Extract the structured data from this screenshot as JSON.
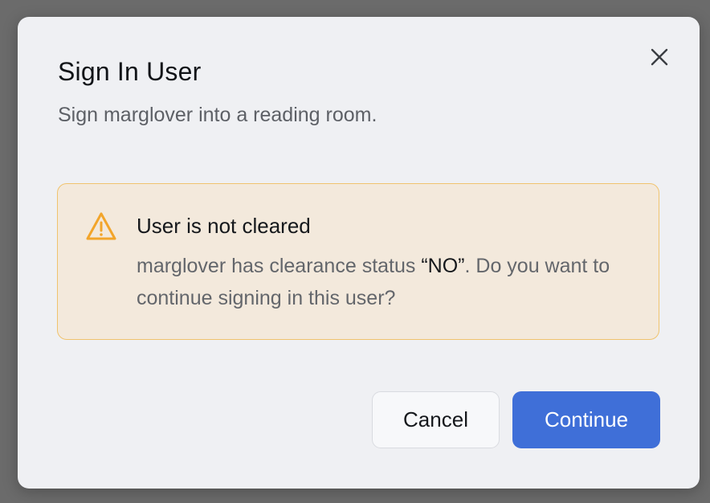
{
  "dialog": {
    "title": "Sign In User",
    "subtitle": "Sign marglover into a reading room.",
    "close_icon": "close-icon"
  },
  "alert": {
    "icon": "warning-triangle-icon",
    "title": "User is not cleared",
    "body_prefix": "marglover has clearance status ",
    "body_status": "“NO”",
    "body_suffix": ". Do you want to continue signing in this user?"
  },
  "actions": {
    "cancel_label": "Cancel",
    "continue_label": "Continue"
  },
  "colors": {
    "overlay": "#6b6b6b",
    "dialog_bg": "#eff0f3",
    "alert_bg": "#f3e9dc",
    "alert_border": "#f0c36e",
    "warning_icon": "#f2a52b",
    "primary": "#3f6fd8"
  }
}
